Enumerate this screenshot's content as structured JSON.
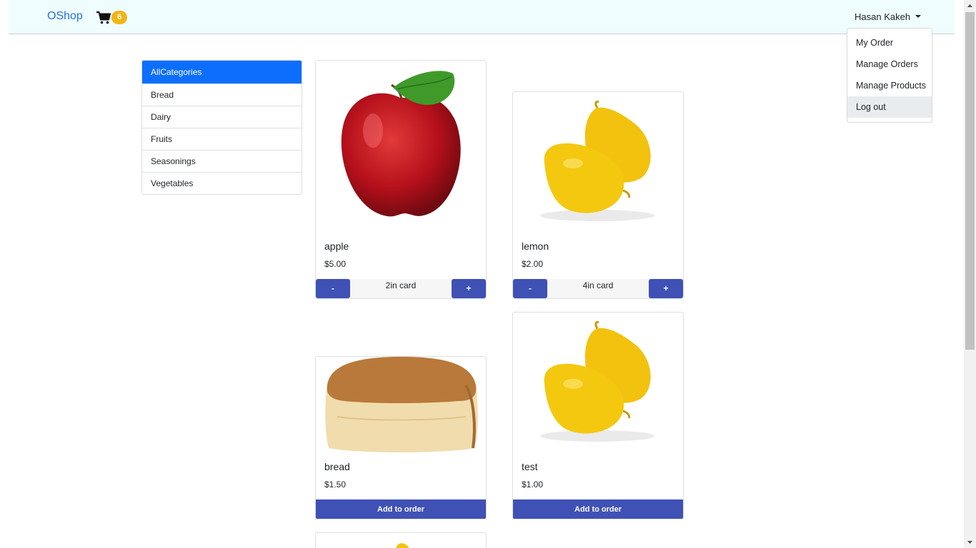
{
  "navbar": {
    "brand": "OShop",
    "cart_count": "6",
    "user_name": "Hasan Kakeh"
  },
  "user_menu": {
    "items": [
      "My Order",
      "Manage Orders",
      "Manage Products",
      "Log out"
    ]
  },
  "categories": [
    "AllCategories",
    "Bread",
    "Dairy",
    "Fruits",
    "Seasonings",
    "Vegetables"
  ],
  "products": [
    {
      "name": "apple",
      "price": "$5.00",
      "quantity_label": "2in card",
      "minus": "-",
      "plus": "+"
    },
    {
      "name": "lemon",
      "price": "$2.00",
      "quantity_label": "4in card",
      "minus": "-",
      "plus": "+"
    },
    {
      "name": "bread",
      "price": "$1.50",
      "action": "Add to order"
    },
    {
      "name": "test",
      "price": "$1.00",
      "action": "Add to order"
    }
  ],
  "colors": {
    "brand": "#1e73e8",
    "navbar_bg": "#f0fdff",
    "badge": "#f3b515",
    "active_category": "#0d6efd",
    "button": "#3f51b5"
  },
  "icons": {
    "cart": "shopping-cart-icon",
    "user_caret": "caret-down-icon"
  }
}
